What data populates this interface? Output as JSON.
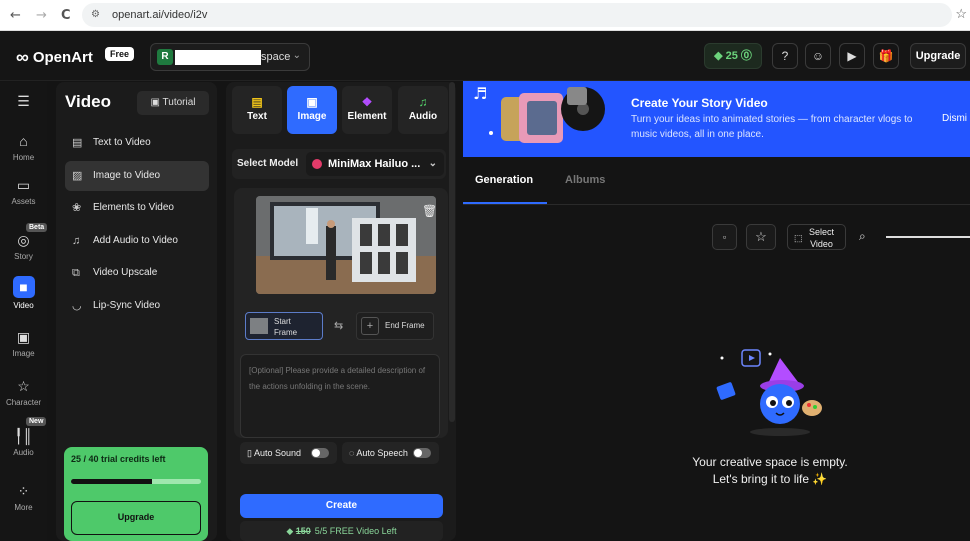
{
  "browser": {
    "back": "←",
    "forward": "→",
    "reload": "C",
    "url": "openart.ai/video/i2v",
    "bookmark": "☆"
  },
  "header": {
    "brand": "OpenArt",
    "plan_badge": "Free",
    "workspace_initial": "R",
    "workspace_suffix": "space",
    "credits": "25",
    "upgrade_label": "Upgrade"
  },
  "rail": {
    "items": [
      {
        "label": "Home",
        "icon": "home-icon"
      },
      {
        "label": "Assets",
        "icon": "folder-icon"
      },
      {
        "label": "Story",
        "icon": "story-icon",
        "badge": "Beta"
      },
      {
        "label": "Video",
        "icon": "video-icon"
      },
      {
        "label": "Image",
        "icon": "image-icon"
      },
      {
        "label": "Character",
        "icon": "character-icon"
      },
      {
        "label": "Audio",
        "icon": "audio-icon",
        "badge": "New"
      },
      {
        "label": "More",
        "icon": "more-icon"
      }
    ]
  },
  "menu": {
    "title": "Video",
    "tutorial": "Tutorial",
    "items": [
      {
        "label": "Text to Video"
      },
      {
        "label": "Image to Video"
      },
      {
        "label": "Elements to Video"
      },
      {
        "label": "Add Audio to Video"
      },
      {
        "label": "Video Upscale"
      },
      {
        "label": "Lip-Sync Video"
      }
    ],
    "trial_text": "25 / 40 trial credits left",
    "trial_progress": 0.62,
    "trial_upgrade": "Upgrade"
  },
  "composer": {
    "tabs": [
      {
        "label": "Text",
        "icon": "text-icon",
        "color": "#f0c419"
      },
      {
        "label": "Image",
        "icon": "image-icon",
        "color": "#ffffff"
      },
      {
        "label": "Element",
        "icon": "element-icon",
        "color": "#b34dff"
      },
      {
        "label": "Audio",
        "icon": "audio-icon",
        "color": "#55d46b"
      }
    ],
    "select_model_label": "Select Model",
    "model_value": "MiniMax Hailuo ...",
    "start_frame": [
      "Start",
      "Frame"
    ],
    "end_frame": "End Frame",
    "prompt_placeholder": "[Optional] Please provide a detailed description of the actions unfolding in the scene.",
    "auto_sound": "Auto Sound",
    "auto_speech": "Auto Speech",
    "create_label": "Create",
    "old_cost": "150",
    "free_left": "5/5 FREE Video Left"
  },
  "banner": {
    "title": "Create Your Story Video",
    "text": "Turn your ideas into animated stories — from character vlogs to music videos, all in one place.",
    "dismiss": "Dismi"
  },
  "results": {
    "tabs": [
      "Generation",
      "Albums"
    ],
    "select_video": [
      "Select",
      "Video"
    ],
    "empty_line1": "Your creative space is empty.",
    "empty_line2": "Let's bring it to life ✨"
  }
}
